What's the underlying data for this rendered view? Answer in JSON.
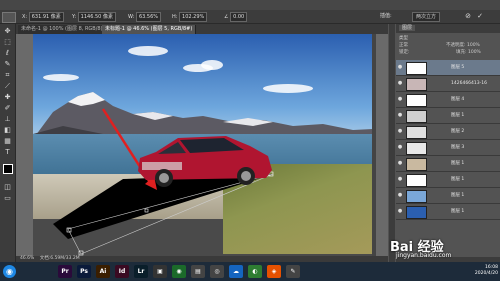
{
  "app": {
    "name": "Photoshop"
  },
  "options_bar": {
    "x_label": "X:",
    "x_value": "631.91 像素",
    "y_label": "Y:",
    "y_value": "1146.50 像素",
    "w_label": "W:",
    "w_value": "63.56%",
    "h_label": "H:",
    "h_value": "102.29%",
    "angle_label": "∠",
    "angle_value": "0.00",
    "interp_label": "插值:",
    "interp_value": "两次立方",
    "cancel": "⊘",
    "commit": "✓"
  },
  "document": {
    "tabs": [
      {
        "label": "未命名-1 @ 100% (图层 8, RGB/8)"
      },
      {
        "label": "未标题-1 @ 46.6% (图层 5, RGB/8#)"
      }
    ],
    "status_zoom": "46.6%",
    "status_doc": "文档:6.59M/33.2M"
  },
  "layers_panel": {
    "tab": "图层",
    "kind_label": "类型",
    "mode_label": "正常",
    "opacity_label": "不透明度:",
    "opacity_value": "100%",
    "lock_label": "锁定:",
    "fill_label": "填充:",
    "fill_value": "100%",
    "layers": [
      {
        "name": "图层 5",
        "selected": true,
        "thumb": "#ffffff"
      },
      {
        "name": "1426466413-16",
        "selected": false,
        "thumb": "#c8b6b6"
      },
      {
        "name": "图层 4",
        "selected": false,
        "thumb": "#ffffff"
      },
      {
        "name": "图层 1",
        "selected": false,
        "thumb": "#d0d0d0"
      },
      {
        "name": "图层 2",
        "selected": false,
        "thumb": "#e0e0e0"
      },
      {
        "name": "图层 3",
        "selected": false,
        "thumb": "#e8e8e8"
      },
      {
        "name": "图层 1",
        "selected": false,
        "thumb": "#c9b9a0"
      },
      {
        "name": "图层 1",
        "selected": false,
        "thumb": "#ffffff"
      },
      {
        "name": "图层 1",
        "selected": false,
        "thumb": "#7aa7d8"
      },
      {
        "name": "图层 1",
        "selected": false,
        "thumb": "#2b5fb0"
      }
    ]
  },
  "taskbar": {
    "apps": [
      {
        "label": "Pr",
        "color": "#2a0a3a"
      },
      {
        "label": "Ps",
        "color": "#0a1a3a"
      },
      {
        "label": "Ai",
        "color": "#3a1e00"
      },
      {
        "label": "Id",
        "color": "#3a0a22"
      },
      {
        "label": "Lr",
        "color": "#0a1e2a"
      },
      {
        "label": "▣",
        "color": "#333333"
      },
      {
        "label": "◉",
        "color": "#1b6a2a"
      },
      {
        "label": "▤",
        "color": "#444444"
      },
      {
        "label": "◎",
        "color": "#444444"
      },
      {
        "label": "☁",
        "color": "#1565c0"
      },
      {
        "label": "◐",
        "color": "#2e7d32"
      },
      {
        "label": "◈",
        "color": "#e65100"
      },
      {
        "label": "✎",
        "color": "#444444"
      }
    ],
    "time": "16:08",
    "date": "2020/4/20"
  },
  "watermark": {
    "brand": "Bai 经验",
    "url": "jingyan.baidu.com"
  }
}
